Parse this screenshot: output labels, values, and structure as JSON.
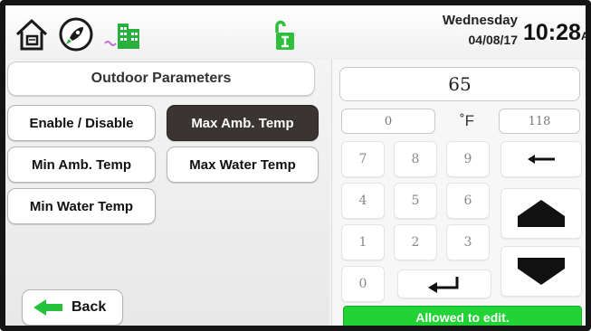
{
  "header": {
    "icons": [
      "home-icon",
      "rocket-icon",
      "building-icon",
      "lock-icon"
    ],
    "day": "Wednesday",
    "date": "04/08/17",
    "time": "10:28",
    "ampm": "AM"
  },
  "left_panel": {
    "title": "Outdoor Parameters",
    "buttons": {
      "enable_disable": "Enable / Disable",
      "max_amb_temp": "Max Amb. Temp",
      "min_amb_temp": "Min Amb. Temp",
      "max_water_temp": "Max Water Temp",
      "min_water_temp": "Min Water Temp"
    },
    "selected": "Max Amb. Temp",
    "back_label": "Back"
  },
  "keypad": {
    "value": "65",
    "min": "0",
    "max": "118",
    "unit": "˚F",
    "keys": [
      "7",
      "8",
      "9",
      "4",
      "5",
      "6",
      "1",
      "2",
      "3",
      "0"
    ],
    "status": "Allowed to edit."
  },
  "colors": {
    "selected_button": "#3a3533",
    "status_green": "#21d335",
    "icon_green": "#27b03c",
    "lock_green": "#2fbf3a"
  }
}
